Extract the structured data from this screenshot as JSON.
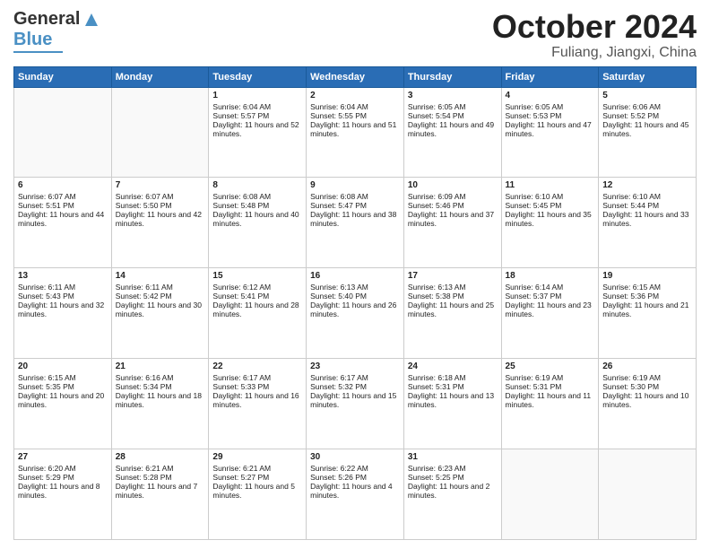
{
  "header": {
    "logo_line1": "General",
    "logo_line2": "Blue",
    "title": "October 2024",
    "location": "Fuliang, Jiangxi, China"
  },
  "weekdays": [
    "Sunday",
    "Monday",
    "Tuesday",
    "Wednesday",
    "Thursday",
    "Friday",
    "Saturday"
  ],
  "weeks": [
    [
      {
        "day": "",
        "empty": true
      },
      {
        "day": "",
        "empty": true
      },
      {
        "day": "1",
        "sunrise": "Sunrise: 6:04 AM",
        "sunset": "Sunset: 5:57 PM",
        "daylight": "Daylight: 11 hours and 52 minutes."
      },
      {
        "day": "2",
        "sunrise": "Sunrise: 6:04 AM",
        "sunset": "Sunset: 5:55 PM",
        "daylight": "Daylight: 11 hours and 51 minutes."
      },
      {
        "day": "3",
        "sunrise": "Sunrise: 6:05 AM",
        "sunset": "Sunset: 5:54 PM",
        "daylight": "Daylight: 11 hours and 49 minutes."
      },
      {
        "day": "4",
        "sunrise": "Sunrise: 6:05 AM",
        "sunset": "Sunset: 5:53 PM",
        "daylight": "Daylight: 11 hours and 47 minutes."
      },
      {
        "day": "5",
        "sunrise": "Sunrise: 6:06 AM",
        "sunset": "Sunset: 5:52 PM",
        "daylight": "Daylight: 11 hours and 45 minutes."
      }
    ],
    [
      {
        "day": "6",
        "sunrise": "Sunrise: 6:07 AM",
        "sunset": "Sunset: 5:51 PM",
        "daylight": "Daylight: 11 hours and 44 minutes."
      },
      {
        "day": "7",
        "sunrise": "Sunrise: 6:07 AM",
        "sunset": "Sunset: 5:50 PM",
        "daylight": "Daylight: 11 hours and 42 minutes."
      },
      {
        "day": "8",
        "sunrise": "Sunrise: 6:08 AM",
        "sunset": "Sunset: 5:48 PM",
        "daylight": "Daylight: 11 hours and 40 minutes."
      },
      {
        "day": "9",
        "sunrise": "Sunrise: 6:08 AM",
        "sunset": "Sunset: 5:47 PM",
        "daylight": "Daylight: 11 hours and 38 minutes."
      },
      {
        "day": "10",
        "sunrise": "Sunrise: 6:09 AM",
        "sunset": "Sunset: 5:46 PM",
        "daylight": "Daylight: 11 hours and 37 minutes."
      },
      {
        "day": "11",
        "sunrise": "Sunrise: 6:10 AM",
        "sunset": "Sunset: 5:45 PM",
        "daylight": "Daylight: 11 hours and 35 minutes."
      },
      {
        "day": "12",
        "sunrise": "Sunrise: 6:10 AM",
        "sunset": "Sunset: 5:44 PM",
        "daylight": "Daylight: 11 hours and 33 minutes."
      }
    ],
    [
      {
        "day": "13",
        "sunrise": "Sunrise: 6:11 AM",
        "sunset": "Sunset: 5:43 PM",
        "daylight": "Daylight: 11 hours and 32 minutes."
      },
      {
        "day": "14",
        "sunrise": "Sunrise: 6:11 AM",
        "sunset": "Sunset: 5:42 PM",
        "daylight": "Daylight: 11 hours and 30 minutes."
      },
      {
        "day": "15",
        "sunrise": "Sunrise: 6:12 AM",
        "sunset": "Sunset: 5:41 PM",
        "daylight": "Daylight: 11 hours and 28 minutes."
      },
      {
        "day": "16",
        "sunrise": "Sunrise: 6:13 AM",
        "sunset": "Sunset: 5:40 PM",
        "daylight": "Daylight: 11 hours and 26 minutes."
      },
      {
        "day": "17",
        "sunrise": "Sunrise: 6:13 AM",
        "sunset": "Sunset: 5:38 PM",
        "daylight": "Daylight: 11 hours and 25 minutes."
      },
      {
        "day": "18",
        "sunrise": "Sunrise: 6:14 AM",
        "sunset": "Sunset: 5:37 PM",
        "daylight": "Daylight: 11 hours and 23 minutes."
      },
      {
        "day": "19",
        "sunrise": "Sunrise: 6:15 AM",
        "sunset": "Sunset: 5:36 PM",
        "daylight": "Daylight: 11 hours and 21 minutes."
      }
    ],
    [
      {
        "day": "20",
        "sunrise": "Sunrise: 6:15 AM",
        "sunset": "Sunset: 5:35 PM",
        "daylight": "Daylight: 11 hours and 20 minutes."
      },
      {
        "day": "21",
        "sunrise": "Sunrise: 6:16 AM",
        "sunset": "Sunset: 5:34 PM",
        "daylight": "Daylight: 11 hours and 18 minutes."
      },
      {
        "day": "22",
        "sunrise": "Sunrise: 6:17 AM",
        "sunset": "Sunset: 5:33 PM",
        "daylight": "Daylight: 11 hours and 16 minutes."
      },
      {
        "day": "23",
        "sunrise": "Sunrise: 6:17 AM",
        "sunset": "Sunset: 5:32 PM",
        "daylight": "Daylight: 11 hours and 15 minutes."
      },
      {
        "day": "24",
        "sunrise": "Sunrise: 6:18 AM",
        "sunset": "Sunset: 5:31 PM",
        "daylight": "Daylight: 11 hours and 13 minutes."
      },
      {
        "day": "25",
        "sunrise": "Sunrise: 6:19 AM",
        "sunset": "Sunset: 5:31 PM",
        "daylight": "Daylight: 11 hours and 11 minutes."
      },
      {
        "day": "26",
        "sunrise": "Sunrise: 6:19 AM",
        "sunset": "Sunset: 5:30 PM",
        "daylight": "Daylight: 11 hours and 10 minutes."
      }
    ],
    [
      {
        "day": "27",
        "sunrise": "Sunrise: 6:20 AM",
        "sunset": "Sunset: 5:29 PM",
        "daylight": "Daylight: 11 hours and 8 minutes."
      },
      {
        "day": "28",
        "sunrise": "Sunrise: 6:21 AM",
        "sunset": "Sunset: 5:28 PM",
        "daylight": "Daylight: 11 hours and 7 minutes."
      },
      {
        "day": "29",
        "sunrise": "Sunrise: 6:21 AM",
        "sunset": "Sunset: 5:27 PM",
        "daylight": "Daylight: 11 hours and 5 minutes."
      },
      {
        "day": "30",
        "sunrise": "Sunrise: 6:22 AM",
        "sunset": "Sunset: 5:26 PM",
        "daylight": "Daylight: 11 hours and 4 minutes."
      },
      {
        "day": "31",
        "sunrise": "Sunrise: 6:23 AM",
        "sunset": "Sunset: 5:25 PM",
        "daylight": "Daylight: 11 hours and 2 minutes."
      },
      {
        "day": "",
        "empty": true
      },
      {
        "day": "",
        "empty": true
      }
    ]
  ]
}
